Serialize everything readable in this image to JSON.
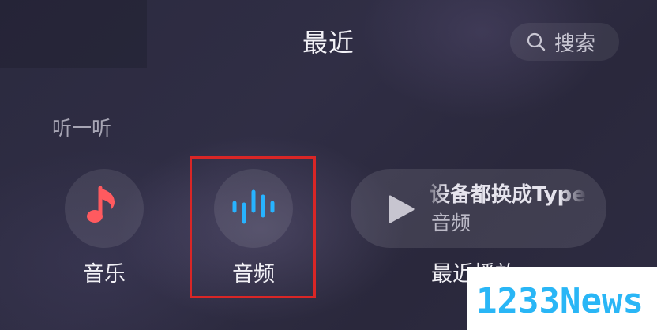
{
  "header": {
    "title": "最近",
    "search_label": "搜索",
    "search_icon": "magnifier-icon"
  },
  "section": {
    "title": "听一听"
  },
  "tiles": [
    {
      "label": "音乐",
      "icon": "music-note-icon",
      "icon_color": "#ff5a5f"
    },
    {
      "label": "音频",
      "icon": "audio-wave-icon",
      "icon_color": "#27b3ff",
      "highlighted": true
    }
  ],
  "recent_card": {
    "title": "设备都换成Type",
    "subtitle": "音频",
    "icon": "play-icon",
    "label": "最近播放"
  },
  "overlay": {
    "watermark": "1233News"
  },
  "colors": {
    "background": "#2c2b40",
    "highlight_border": "#d92626",
    "watermark_text": "#29b6f6"
  }
}
